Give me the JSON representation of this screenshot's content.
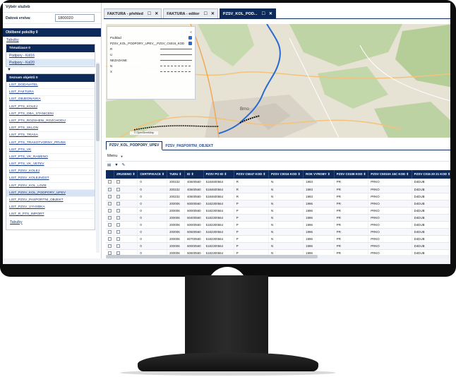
{
  "sidebar": {
    "title": "Výběr služeb",
    "data_layer_label": "Datová vrstva:",
    "data_layer_value": "1800020",
    "favorites_header": "Oblíbené položky 0",
    "favorites_link": "Tabulky",
    "themes_header": "Tématizace 0",
    "themes_items": [
      "Podpory - Kol16",
      "Podpory - Kol20"
    ],
    "objects_header": "Seznam objektů 0",
    "objects": [
      "LIST_DODAVATEL",
      "LIST_FAKTURA",
      "LIST_OBJEDNAVKA",
      "LIST_PTS_KOLEJ",
      "LIST_PTS_OBA_STANICENI",
      "LIST_PTS_ROZSHENI_ROZCHODU",
      "LIST_PTS_SKLON",
      "LIST_PTS_TRASA",
      "LIST_PTS_TRASOTVORNY_PRVEK",
      "LIST_PTS_VK",
      "LIST_PTS_VK_RAMENO",
      "LIST_PTS_VK_VETEV",
      "LIST_PZSV_KOLEJ",
      "LIST_PZSV_KOLEJNOST",
      "LIST_PZSV_KOL_LOZE",
      "LIST_PZSV_KOL_PODPORY_UPEV",
      "LIST_PZSV_PASPORTNI_OBJEKT",
      "LIST_PZSV_VYHYBKA",
      "LIST_R_PTS_IMPORT"
    ],
    "objects_footer_link": "Tabulky"
  },
  "tabs": [
    {
      "label": "FAKTURA - přehled",
      "active": false
    },
    {
      "label": "FAKTURA - editor",
      "active": false
    },
    {
      "label": "PZSV_KOL_POD...",
      "active": true
    }
  ],
  "map_legend": {
    "collapse_icon": "<",
    "rows": [
      {
        "label": "Podklad",
        "kind": "check"
      },
      {
        "label": "PZSV_KOL_PODPORY_UPEV__PZSV_C5016_KOD",
        "kind": "check"
      },
      {
        "label": "R",
        "kind": "line"
      },
      {
        "label": "U",
        "kind": "line"
      },
      {
        "label": "NEZADANE",
        "kind": "line"
      },
      {
        "label": "N",
        "kind": "dash"
      },
      {
        "label": "X",
        "kind": "dash"
      }
    ]
  },
  "map": {
    "city_label": "Brno",
    "attribution": "© OpenStreetMap"
  },
  "bottom_tabs": [
    "PZSV_KOL_PODPORY_UPEV",
    "PZSV_PASPORTNI_OBJEKT"
  ],
  "menu_label": "Menu",
  "toolbar_icons": [
    "list-icon",
    "filter-icon",
    "edit-icon"
  ],
  "table": {
    "columns": [
      "ZRUSENO ⇕",
      "CERTIFIKACE ⇕",
      "TUDU ⇕",
      "ID ⇕",
      "PZSV PO ID ⇕",
      "PZSV C5047 KOD ⇕",
      "PZSV C0016 KOD ⇕",
      "ROK VYROBY ⇕",
      "PZSV C0108 KOD ⇕",
      "PZSV C5010A 15C KOD ⇕",
      "PZSV C015 20 21 KOD ⇕"
    ],
    "rows": [
      [
        "",
        "0",
        "200232",
        "40600560",
        "5184600564",
        "R",
        "N",
        "1993",
        "PR",
        "PRKO",
        "D4DUB"
      ],
      [
        "",
        "0",
        "200232",
        "40600560",
        "5184600564",
        "R",
        "N",
        "1993",
        "PR",
        "PRKO",
        "D4DUB"
      ],
      [
        "",
        "0",
        "200232",
        "40600560",
        "5184600564",
        "R",
        "N",
        "1993",
        "PR",
        "PRKO",
        "D4DUB"
      ],
      [
        "",
        "0",
        "200006",
        "60000560",
        "5182300564",
        "P",
        "N",
        "1996",
        "PR",
        "PRKO",
        "D4DUB"
      ],
      [
        "",
        "0",
        "200006",
        "60000560",
        "5182300564",
        "P",
        "N",
        "1996",
        "PR",
        "PRKO",
        "D4DUB"
      ],
      [
        "",
        "0",
        "200006",
        "60400560",
        "5182300564",
        "P",
        "N",
        "1996",
        "PR",
        "PRKO",
        "D4DUB"
      ],
      [
        "",
        "0",
        "200006",
        "60000560",
        "5182300564",
        "P",
        "N",
        "1996",
        "PR",
        "PRKO",
        "D4DUB"
      ],
      [
        "",
        "0",
        "200006",
        "60500560",
        "5182300564",
        "P",
        "N",
        "1996",
        "PR",
        "PRKO",
        "D4DUB"
      ],
      [
        "",
        "0",
        "200006",
        "60700560",
        "5182300564",
        "P",
        "N",
        "1996",
        "PR",
        "PRKO",
        "D4DUB"
      ],
      [
        "",
        "0",
        "200006",
        "60000560",
        "5182300564",
        "P",
        "N",
        "1996",
        "PR",
        "PRKO",
        "D4DUB"
      ],
      [
        "",
        "0",
        "200006",
        "60600560",
        "5182300564",
        "P",
        "N",
        "1996",
        "PR",
        "PRKO",
        "D4DUB"
      ]
    ]
  },
  "colors": {
    "navy": "#0d2a5a",
    "link": "#1a3a8a",
    "map_bg": "#e8e4d8",
    "forest": "#b9d1a0",
    "rail_blue": "#2a6ad0"
  }
}
